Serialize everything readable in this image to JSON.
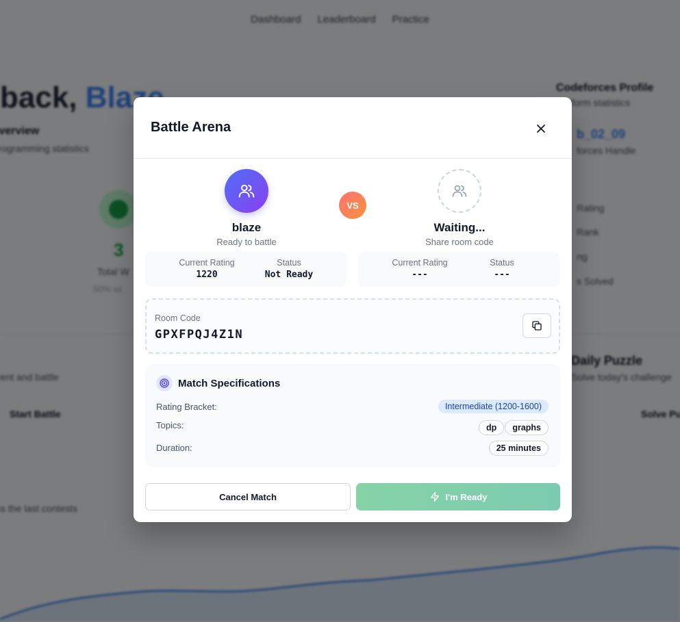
{
  "background": {
    "nav": [
      "Dashboard",
      "Leaderboard",
      "Practice"
    ],
    "welcome_prefix": "back, ",
    "welcome_name": "Blaze",
    "overview_title": "Overview",
    "overview_sub": "programming statistics",
    "stat_number": "3",
    "stat_label": "Total W",
    "stat_sub": "50% wi",
    "profile_title": "Codeforces Profile",
    "profile_sub": "platform statistics",
    "profile_handle": "b_02_09",
    "profile_handle_sub": "forces Handle",
    "profile_rows": [
      "Rating",
      "Rank",
      "ng",
      "s Solved"
    ],
    "battle_sub": "rent and battle",
    "start_battle": "Start Battle",
    "daily_title": "Daily Puzzle",
    "daily_sub": "Solve today's challenge",
    "solve_label": "Solve Pu",
    "contests_sub": "ss the last contests"
  },
  "modal": {
    "title": "Battle Arena",
    "vs": "VS",
    "player1": {
      "name": "blaze",
      "subtitle": "Ready to battle",
      "rating_label": "Current Rating",
      "rating": "1220",
      "status_label": "Status",
      "status": "Not Ready"
    },
    "player2": {
      "name": "Waiting...",
      "subtitle": "Share room code",
      "rating_label": "Current Rating",
      "rating": "---",
      "status_label": "Status",
      "status": "---"
    },
    "room": {
      "label": "Room Code",
      "code": "GPXFPQJ4Z1N"
    },
    "specs": {
      "title": "Match Specifications",
      "rating_bracket_label": "Rating Bracket:",
      "rating_bracket": "Intermediate (1200-1600)",
      "topics_label": "Topics:",
      "topics": [
        "dp",
        "graphs"
      ],
      "duration_label": "Duration:",
      "duration": "25 minutes"
    },
    "buttons": {
      "cancel": "Cancel Match",
      "ready": "I'm Ready"
    }
  },
  "colors": {
    "accent_avatar": "#6366f1",
    "vs_badge": "#fb7a6a",
    "ready_button": "#86d3a7",
    "chip_blue": "#dbeafe"
  },
  "icons": {
    "close": "close-icon",
    "users": "users-icon",
    "copy": "copy-icon",
    "target": "target-icon",
    "lightning": "lightning-icon"
  }
}
